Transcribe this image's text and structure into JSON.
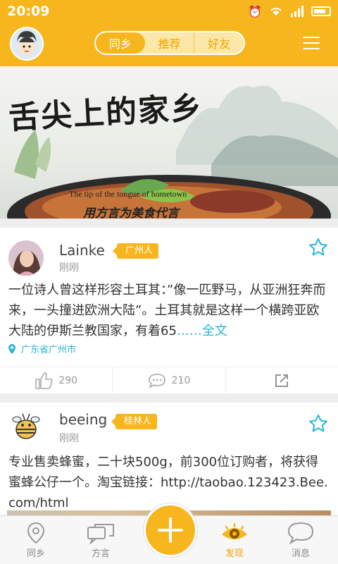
{
  "status_bar": {
    "time": "20:09",
    "icons": [
      "alarm-icon",
      "wifi-icon",
      "signal-icon",
      "battery-icon"
    ]
  },
  "header": {
    "tabs": [
      {
        "label": "同乡",
        "active": true
      },
      {
        "label": "推荐",
        "active": false
      },
      {
        "label": "好友",
        "active": false
      }
    ],
    "menu_icon": "hamburger-menu-icon"
  },
  "banner": {
    "title": "舌尖上的家乡",
    "subtitle_en": "The tip of the tongue of hometown",
    "slogan": "用方言为美食代言"
  },
  "posts": [
    {
      "username": "Lainke",
      "badge": "广州人",
      "time": "刚刚",
      "text": "一位诗人曾这样形容土耳其：”像一匹野马，从亚洲狂奔而来，一头撞进欧洲大陆”。土耳其就是这样一个横跨亚欧大陆的伊斯兰教国家，有着65",
      "more": "……全文",
      "location": "广东省广州市",
      "likes": "290",
      "comments": "210"
    },
    {
      "username": "beeing",
      "badge": "桂林人",
      "time": "刚刚",
      "text": "专业售卖蜂蜜，二十块500g，前300位订购者，将获得蜜蜂公仔一个。淘宝链接：http://taobao.123423.Bee.com/html"
    }
  ],
  "tabbar": {
    "items": [
      {
        "label": "同乡",
        "icon": "location-pin-icon"
      },
      {
        "label": "方言",
        "icon": "chat-bubbles-icon"
      },
      {
        "label": "发现",
        "icon": "eye-icon",
        "active": true
      },
      {
        "label": "消息",
        "icon": "message-bubble-icon"
      }
    ],
    "fab_icon": "plus-icon"
  },
  "colors": {
    "brand": "#f7b61e",
    "link": "#27b6d8"
  }
}
